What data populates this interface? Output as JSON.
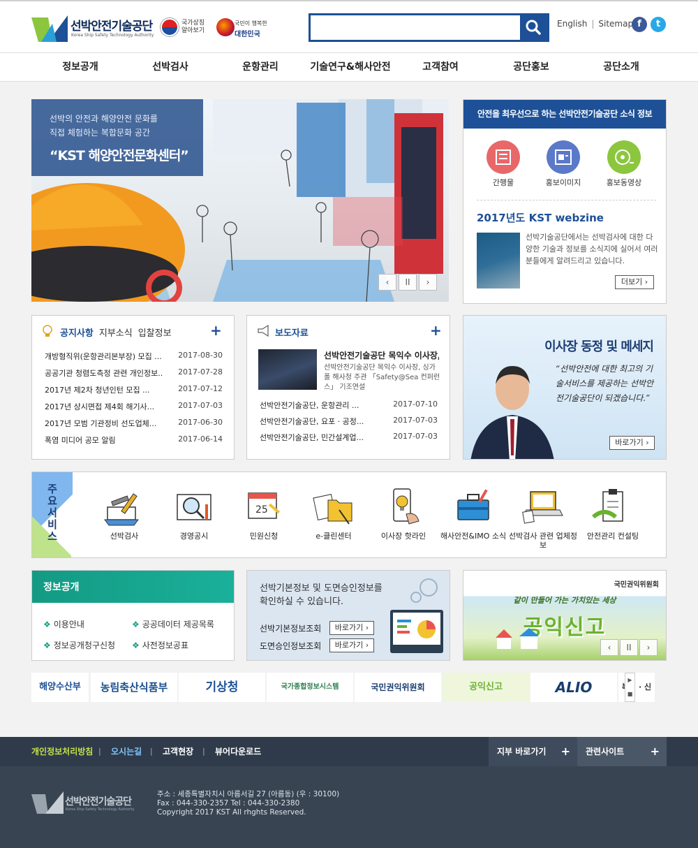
{
  "header": {
    "logo_name": "선박안전기술공단",
    "logo_sub": "Korea Ship Safety Technology Authority",
    "national_symbol": "국가상징 알아보기",
    "slogan_small": "국민이 행복한",
    "slogan_big": "대한민국",
    "search_placeholder": "",
    "util_english": "English",
    "util_sitemap": "Sitemap",
    "facebook": "f",
    "twitter": "t"
  },
  "gnb": [
    "정보공개",
    "선박검사",
    "운항관리",
    "기술연구&해사안전",
    "고객참여",
    "공단홍보",
    "공단소개"
  ],
  "hero": {
    "sub_line1": "선박의 안전과 해양안전 문화를",
    "sub_line2": "직접 체험하는 복합문화 공간",
    "title": "“KST 해양안전문화센터”",
    "prev": "‹",
    "pause": "II",
    "next": "›"
  },
  "newsbox": {
    "head": "안전을 최우선으로 하는 선박안전기술공단 소식 정보",
    "items": [
      {
        "label": "간행물",
        "color": "#e8686a"
      },
      {
        "label": "홍보이미지",
        "color": "#5b79c9"
      },
      {
        "label": "홍보동영상",
        "color": "#8cc63f"
      }
    ],
    "webzine_title": "2017년도 KST webzine",
    "webzine_desc": "선박기술공단에서는 선박검사에 대한 다양한 기술과 정보를 소식지에 실어서 여러분들에게 알려드리고 있습니다.",
    "more": "더보기 ›"
  },
  "notice": {
    "tabs": [
      "공지사항",
      "지부소식",
      "입찰정보"
    ],
    "plus": "+",
    "items": [
      {
        "title": "개방형직위(운항관리본부장) 모집 ...",
        "date": "2017-08-30"
      },
      {
        "title": "공공기관 청렴도측정 관련 개인정보...",
        "date": "2017-07-28"
      },
      {
        "title": "2017년 제2차 청년인턴 모집 ...",
        "date": "2017-07-12"
      },
      {
        "title": "2017년 상시면접 제4회 해기사...",
        "date": "2017-07-03"
      },
      {
        "title": "2017년 모범 기관정비 선도업체...",
        "date": "2017-06-30"
      },
      {
        "title": "폭염 미디어 공모 알림",
        "date": "2017-06-14"
      }
    ]
  },
  "press": {
    "tab": "보도자료",
    "plus": "+",
    "featured_title": "선박안전기술공단 목익수 이사장, ...",
    "featured_desc": "선박안전기술공단 목익수 이사장, 싱가폴 해사청 주관 「Safety@Sea 컨퍼런스」 기조연설",
    "items": [
      {
        "title": "선박안전기술공단, 운항관리 ...",
        "date": "2017-07-10"
      },
      {
        "title": "선박안전기술공단, 요포 · 공정...",
        "date": "2017-07-03"
      },
      {
        "title": "선박안전기술공단, 민간설계업...",
        "date": "2017-07-03"
      }
    ]
  },
  "ceo": {
    "title": "이사장 동정 및 메세지",
    "quote": "“선박안전에 대한 최고의 기술서비스를 제공하는 선박안전기술공단이 되겠습니다.”",
    "button": "바로가기 ›"
  },
  "services": {
    "label": "주요서비스",
    "items": [
      {
        "label": "선박검사",
        "icon": "ship-tools-icon"
      },
      {
        "label": "경영공시",
        "icon": "magnifier-board-icon"
      },
      {
        "label": "민원신청",
        "icon": "calendar-icon"
      },
      {
        "label": "e-클린센터",
        "icon": "folder-icon"
      },
      {
        "label": "이사장 핫라인",
        "icon": "phone-bulb-icon"
      },
      {
        "label": "해사안전&IMO 소식",
        "icon": "briefcase-icon"
      },
      {
        "label": "선박검사 관련 업체정보",
        "icon": "laptop-icon"
      },
      {
        "label": "안전관리 컨설팅",
        "icon": "clipboard-icon"
      }
    ]
  },
  "info": {
    "head": "정보공개",
    "links": [
      "이용안내",
      "공공데이터 제공목록",
      "정보공개청구신청",
      "사전정보공표"
    ],
    "bullet": "❖"
  },
  "shipinfo": {
    "text1": "선박기본정보 및 도면승인정보를",
    "text2": "확인하실 수 있습니다.",
    "row1": "선박기본정보조회",
    "row2": "도면승인정보조회",
    "btn": "바로가기 ›"
  },
  "report": {
    "org": "국민권익위원회",
    "sub": "같이 만들어 가는 가치있는 세상",
    "title": "공익신고",
    "prev": "‹",
    "pause": "II",
    "next": "›"
  },
  "banners": [
    {
      "text": "해양수산부",
      "color": "#1d5096"
    },
    {
      "text": "농림축산식품부",
      "color": "#1a4d8f"
    },
    {
      "text": "기상청",
      "color": "#1d5096"
    },
    {
      "text": "국가종합정보시스템",
      "color": "#2a7d4f"
    },
    {
      "text": "국민권익위원회",
      "color": "#1a3d6e"
    },
    {
      "text": "공익신고",
      "color": "#6ab22f"
    },
    {
      "text": "ALIO",
      "color": "#1a3d6e"
    },
    {
      "text": "복지 · 신",
      "color": "#333"
    }
  ],
  "banner_ctrl": {
    "next": "▶",
    "pause": "■"
  },
  "footer": {
    "links": [
      "개인정보처리방침",
      "오시는길",
      "고객현장",
      "뷰어다운로드"
    ],
    "branch": "지부 바로가기",
    "related": "관련사이트",
    "plus": "+",
    "logo_name": "선박안전기술공단",
    "logo_sub": "Korea Ship Safety Technology Authority",
    "addr1": "주소 : 세종특별자치시 아름서길 27 (아름동) (우 : 30100)",
    "addr2": "Fax : 044-330-2357 Tel : 044-330-2380",
    "addr3": "Copyright 2017 KST All rhghts Reserved."
  }
}
